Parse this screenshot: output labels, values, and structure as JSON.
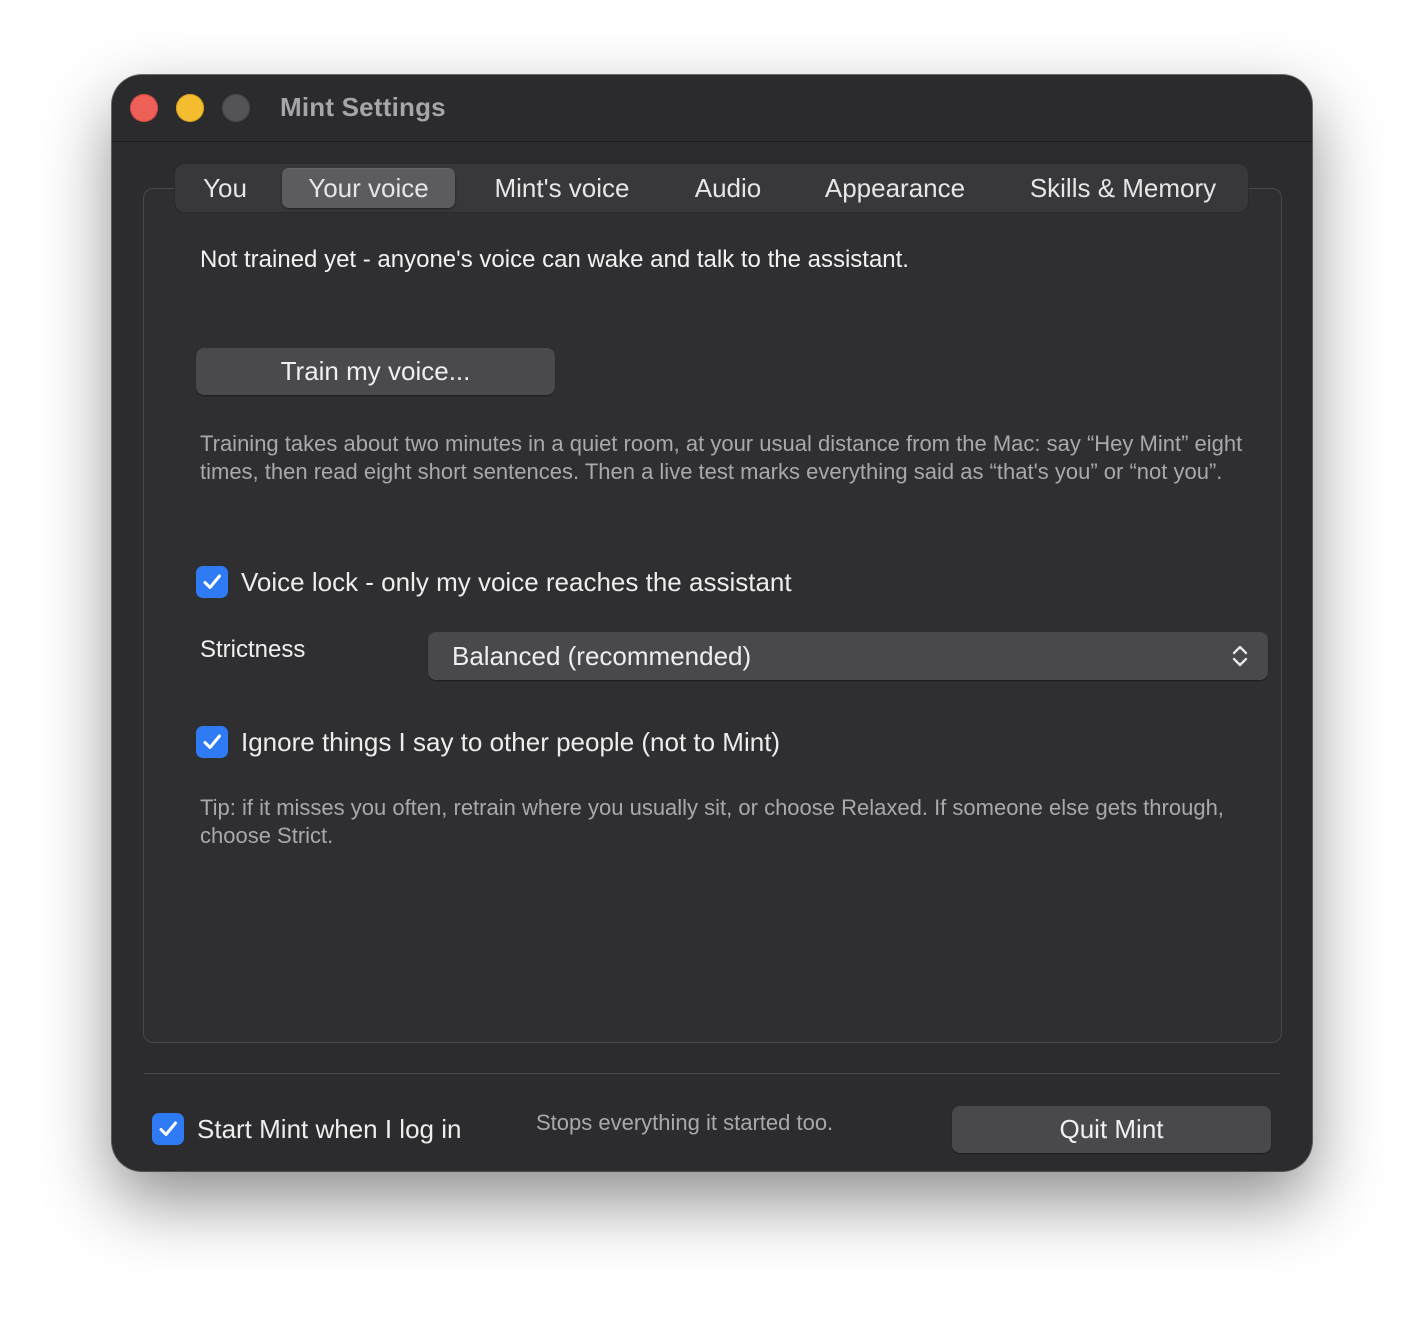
{
  "window": {
    "title": "Mint Settings"
  },
  "tabs": [
    {
      "label": "You",
      "selected": false
    },
    {
      "label": "Your voice",
      "selected": true
    },
    {
      "label": "Mint's voice",
      "selected": false
    },
    {
      "label": "Audio",
      "selected": false
    },
    {
      "label": "Appearance",
      "selected": false
    },
    {
      "label": "Skills & Memory",
      "selected": false
    }
  ],
  "voice_panel": {
    "status": "Not trained yet - anyone's voice can wake and talk to the assistant.",
    "train_button": "Train my voice...",
    "training_help": "Training takes about two minutes in a quiet room, at your usual distance from the Mac: say “Hey Mint” eight times, then read eight short sentences. Then a live test marks everything said as “that's you” or “not you”.",
    "voice_lock": {
      "label": "Voice lock - only my voice reaches the assistant",
      "checked": true
    },
    "strictness": {
      "label": "Strictness",
      "value": "Balanced (recommended)"
    },
    "ignore_others": {
      "label": "Ignore things I say to other people (not to Mint)",
      "checked": true
    },
    "tip": "Tip: if it misses you often, retrain where you usually sit, or choose Relaxed. If someone else gets through, choose Strict."
  },
  "footer": {
    "start_at_login": {
      "label": "Start Mint when I log in",
      "checked": true
    },
    "note": "Stops everything it started too.",
    "quit_button": "Quit Mint"
  },
  "colors": {
    "window_bg": "#2c2b2d",
    "checkbox_accent": "#2f7bf6",
    "close": "#ed5f57",
    "minimize": "#f3bd2f",
    "zoom_inactive": "#545356"
  },
  "icons": {
    "checkmark": "checkmark-icon",
    "select_chevron": "chevron-up-down-icon"
  }
}
